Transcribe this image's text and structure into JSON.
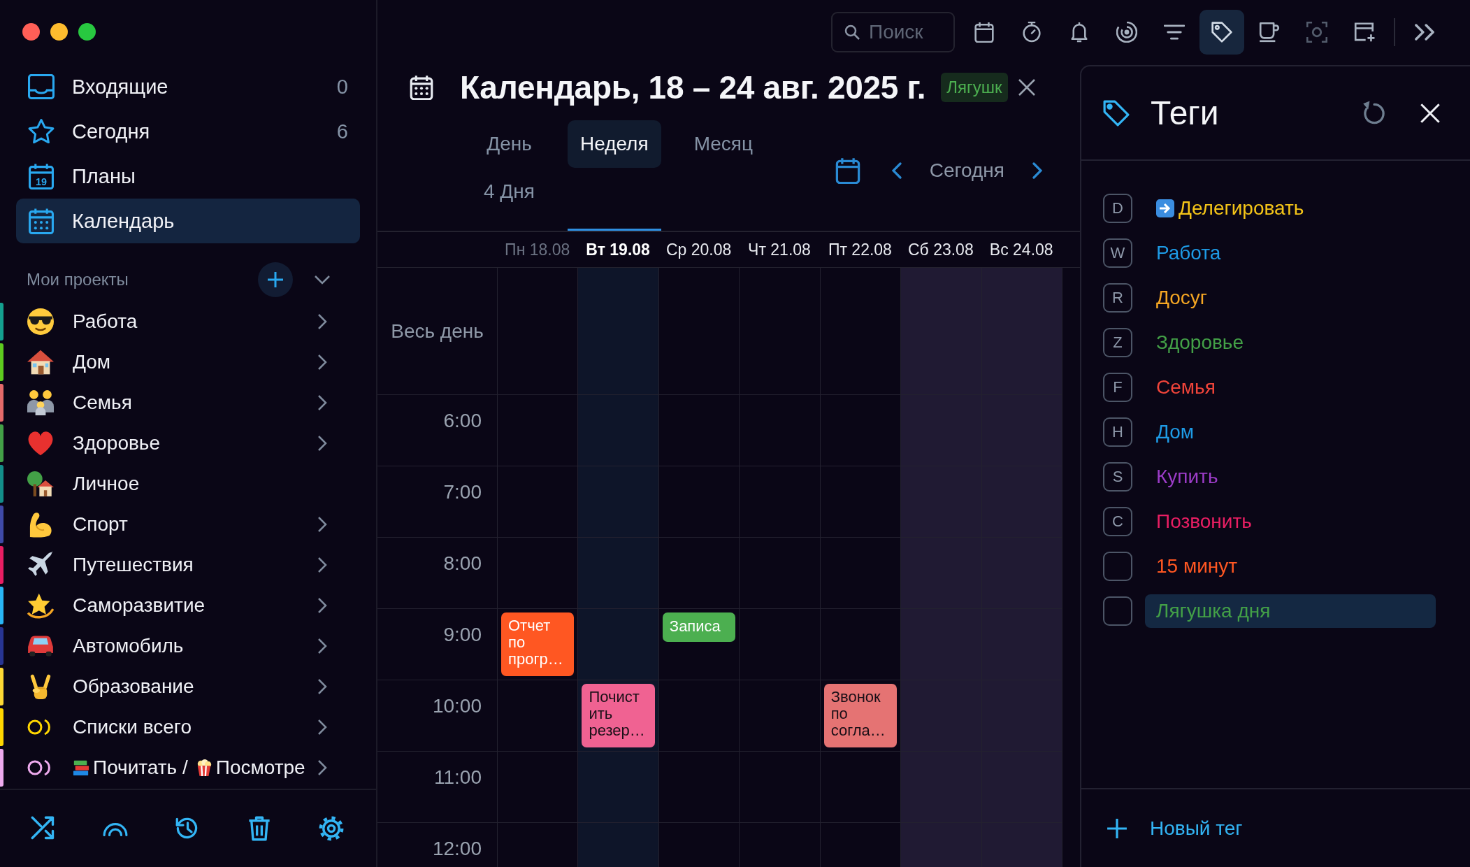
{
  "window_controls": [
    {
      "kind": "close"
    },
    {
      "kind": "minimize"
    },
    {
      "kind": "zoom"
    }
  ],
  "sidebar": {
    "nav": [
      {
        "kind": "inbox",
        "label": "Входящие",
        "count": "0",
        "selected": false
      },
      {
        "kind": "today",
        "label": "Сегодня",
        "count": "6",
        "selected": false
      },
      {
        "kind": "plans",
        "label": "Планы",
        "icon_number": "19",
        "selected": false
      },
      {
        "kind": "calendar",
        "label": "Календарь",
        "selected": true
      }
    ],
    "projects_title": "Мои проекты",
    "projects": [
      {
        "kind": "emoji",
        "label": "Работа",
        "color": "#14a08f",
        "has_children": true
      },
      {
        "kind": "emoji",
        "label": "Дом",
        "color": "#5ecb1f",
        "has_children": true
      },
      {
        "kind": "emoji",
        "label": "Семья",
        "color": "#e46a6a",
        "has_children": true
      },
      {
        "kind": "emoji",
        "label": "Здоровье",
        "color": "#43a047",
        "has_children": true
      },
      {
        "kind": "emoji",
        "label": "Личное",
        "color": "#138e8a",
        "has_children": false
      },
      {
        "kind": "emoji",
        "label": "Спорт",
        "color": "#3f4aa8",
        "has_children": true
      },
      {
        "kind": "emoji",
        "label": "Путешествия",
        "color": "#e91e63",
        "has_children": true
      },
      {
        "kind": "emoji",
        "label": "Саморазвитие",
        "color": "#29b6f6",
        "has_children": true
      },
      {
        "kind": "emoji",
        "label": "Автомобиль",
        "color": "#283593",
        "has_children": true
      },
      {
        "kind": "emoji",
        "label": "Образование",
        "color": "#fdd835",
        "has_children": true
      },
      {
        "kind": "group",
        "label": "Списки всего",
        "color": "#ffd600",
        "has_children": true
      },
      {
        "kind": "group",
        "segments": [
          {
            "text": "Почитать /"
          },
          {
            "text": "Посмотре"
          }
        ],
        "color": "#eeaaee",
        "has_children": true
      }
    ],
    "footer": [
      {
        "kind": "shuffle"
      },
      {
        "kind": "arc"
      },
      {
        "kind": "history"
      },
      {
        "kind": "trash"
      },
      {
        "kind": "settings"
      }
    ]
  },
  "toolbar": {
    "search": {
      "placeholder": "Поиск"
    },
    "buttons": [
      {
        "kind": "calendar",
        "active": false,
        "disabled": false
      },
      {
        "kind": "timer",
        "active": false,
        "disabled": false
      },
      {
        "kind": "notifications",
        "active": false,
        "disabled": false
      },
      {
        "kind": "focus",
        "active": false,
        "disabled": false
      },
      {
        "kind": "filter",
        "active": false,
        "disabled": false
      },
      {
        "kind": "tags",
        "active": true,
        "disabled": false
      },
      {
        "kind": "break",
        "active": false,
        "disabled": false
      },
      {
        "kind": "screenshot",
        "active": false,
        "disabled": true
      },
      {
        "kind": "add-calendar",
        "active": false,
        "disabled": false
      },
      {
        "kind": "more",
        "active": false,
        "disabled": false
      }
    ]
  },
  "header": {
    "title": "Календарь, 18 – 24 авг. 2025 г.",
    "filter_tag": "Лягушк",
    "view_tabs": [
      {
        "label": "День",
        "selected": false
      },
      {
        "label": "Неделя",
        "selected": true
      },
      {
        "label": "Месяц",
        "selected": false
      },
      {
        "label": "4 Дня",
        "selected": false
      }
    ],
    "today_button": "Сегодня"
  },
  "calendar": {
    "all_day_label": "Весь день",
    "days": [
      {
        "kind": "mon",
        "label": "Пн 18.08",
        "past": true,
        "today": false,
        "weekend": false
      },
      {
        "kind": "tue",
        "label": "Вт 19.08",
        "past": false,
        "today": true,
        "weekend": false
      },
      {
        "kind": "wed",
        "label": "Ср 20.08",
        "past": false,
        "today": false,
        "weekend": false
      },
      {
        "kind": "thu",
        "label": "Чт 21.08",
        "past": false,
        "today": false,
        "weekend": false
      },
      {
        "kind": "fri",
        "label": "Пт 22.08",
        "past": false,
        "today": false,
        "weekend": false
      },
      {
        "kind": "sat",
        "label": "Сб 23.08",
        "past": false,
        "today": false,
        "weekend": true
      },
      {
        "kind": "sun",
        "label": "Вс 24.08",
        "past": false,
        "today": false,
        "weekend": true
      }
    ],
    "hours": [
      {
        "label": "6:00"
      },
      {
        "label": "7:00"
      },
      {
        "label": "8:00"
      },
      {
        "label": "9:00",
        "events": [
          {
            "kind": "mon",
            "title": "Отчет по прогр…",
            "color": "#ff5722",
            "short": false,
            "dark_text": false
          },
          {
            "kind": "wed",
            "title": "Записа",
            "color": "#4caf50",
            "short": true,
            "dark_text": false
          }
        ]
      },
      {
        "label": "10:00",
        "events": [
          {
            "kind": "tue",
            "title": "Почистить резер…",
            "color": "#f06292",
            "short": false,
            "dark_text": true
          },
          {
            "kind": "fri",
            "title": "Звонок по согла…",
            "color": "#e57373",
            "short": false,
            "dark_text": true
          }
        ]
      },
      {
        "label": "11:00"
      },
      {
        "label": "12:00"
      }
    ]
  },
  "tags_panel": {
    "title": "Теги",
    "tags": [
      {
        "key": "D",
        "label": "Делегировать",
        "color": "#f5c518",
        "has_icon": true,
        "selected": false
      },
      {
        "key": "W",
        "label": "Работа",
        "color": "#1e9be6",
        "has_icon": false,
        "selected": false
      },
      {
        "key": "R",
        "label": "Досуг",
        "color": "#f5a623",
        "has_icon": false,
        "selected": false
      },
      {
        "key": "Z",
        "label": "Здоровье",
        "color": "#43a047",
        "has_icon": false,
        "selected": false
      },
      {
        "key": "F",
        "label": "Семья",
        "color": "#f0443a",
        "has_icon": false,
        "selected": false
      },
      {
        "key": "H",
        "label": "Дом",
        "color": "#1e9be6",
        "has_icon": false,
        "selected": false
      },
      {
        "key": "S",
        "label": "Купить",
        "color": "#9c3cc8",
        "has_icon": false,
        "selected": false
      },
      {
        "key": "C",
        "label": "Позвонить",
        "color": "#e91e63",
        "has_icon": false,
        "selected": false
      },
      {
        "label": "15 минут",
        "color": "#ff5722",
        "has_icon": false,
        "selected": false
      },
      {
        "label": "Лягушка дня",
        "color": "#43a047",
        "has_icon": false,
        "selected": true
      }
    ],
    "new_tag_button": "Новый тег"
  }
}
